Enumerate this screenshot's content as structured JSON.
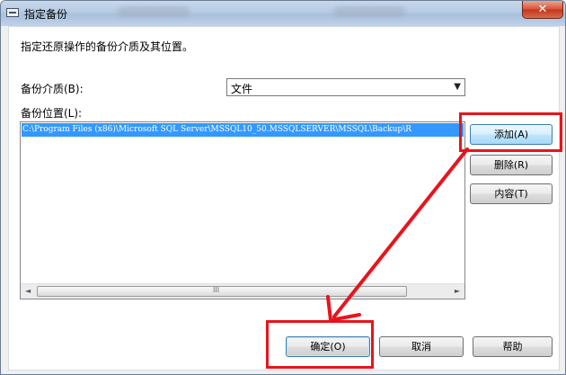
{
  "window": {
    "title": "指定备份",
    "close_glyph": "✕"
  },
  "dialog": {
    "instruction": "指定还原操作的备份介质及其位置。",
    "media_label": "备份介质(B):",
    "media_value": "文件",
    "location_label": "备份位置(L):",
    "locations": [
      "C:\\Program Files (x86)\\Microsoft SQL Server\\MSSQL10_50.MSSQLSERVER\\MSSQL\\Backup\\R"
    ]
  },
  "buttons": {
    "add": "添加(A)",
    "remove": "删除(R)",
    "contents": "内容(T)",
    "ok": "确定(O)",
    "cancel": "取消",
    "help": "帮助"
  },
  "icons": {
    "app": "dialog-window-icon",
    "close": "close-icon",
    "dropdown": "chevron-down-icon",
    "scroll_left": "scroll-left-arrow-icon",
    "scroll_right": "scroll-right-arrow-icon",
    "scroll_grip": "scroll-grip-icon"
  },
  "glyphs": {
    "dropdown": "▼",
    "scroll_left": "◄",
    "scroll_right": "►",
    "scroll_grip": "III"
  },
  "annotation": {
    "highlight_color": "#e8141c"
  }
}
